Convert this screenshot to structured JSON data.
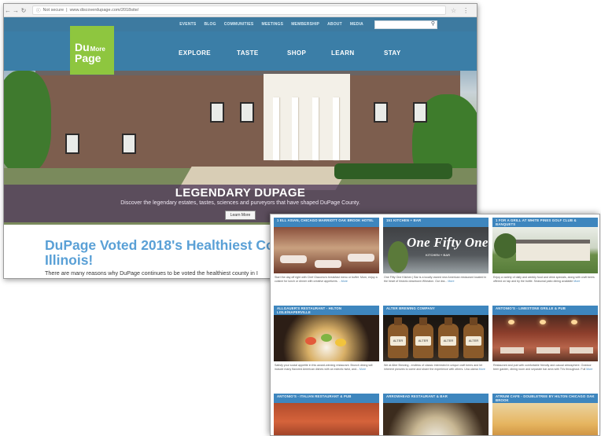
{
  "browser": {
    "security": "Not secure",
    "url": "www.discoverdupage.com/2018site/"
  },
  "site": {
    "top_links": [
      "EVENTS",
      "BLOG",
      "COMMUNITIES",
      "MEETINGS",
      "MEMBERSHIP",
      "ABOUT",
      "MEDIA"
    ],
    "logo_line1": "Du",
    "logo_more": "More",
    "logo_line2": "Page",
    "main_nav": [
      "EXPLORE",
      "TASTE",
      "SHOP",
      "LEARN",
      "STAY"
    ],
    "hero": {
      "title": "LEGENDARY DUPAGE",
      "subtitle": "Discover the legendary estates, tastes, sciences and purveyors that have shaped DuPage County.",
      "button": "Learn More"
    },
    "headline_line1": "DuPage Voted 2018's Healthiest Count",
    "headline_line2": "Illinois!",
    "intro": "There are many reasons why DuPage continues to be voted the healthiest county in I"
  },
  "cards": [
    {
      "title": "1 ELL ASIAN, CHICAGO MARRIOTT OAK BROOK HOTEL",
      "desc": "Start the day off right with Chef Giacomo's breakfast menu or buffet. Mom, enjoy a cuisine for lunch or dinner with creative appetizers.",
      "more": "...More"
    },
    {
      "title": "151 KITCHEN + BAR",
      "desc": "One Fifty One Kitchen | Bar is a locally owned new American restaurant located in the heart of historic downtown Wheaton. Our dra...",
      "more": "More",
      "sign": "One Fifty One",
      "sign_sub": "KITCHEN + BAR"
    },
    {
      "title": "1 FOR A GRILL AT WHITE PINES GOLF CLUB & BANQUETS",
      "desc": "Enjoy a variety of daily and weekly food and drink specials, along with craft beers offered on tap and by the bottle. Seasonal patio dining available",
      "more": "More"
    },
    {
      "title": "ALLGAUER'S RESTAURANT - HILTON LISLE/NAPERVILLE",
      "desc": "Satisfy your social appetite in this award-winning restaurant. Brunch dining will include many flavored American dishes with an eclectic twist, and...",
      "more": "More"
    },
    {
      "title": "ALTER BREWING COMPANY",
      "desc": "We at Alter Brewing - endless of classic interested in unique craft beers and let inherent pictures to come and share the experience with others. Una ulama",
      "more": "More",
      "bottle_label": "ALTER"
    },
    {
      "title": "ANTONIO'S - LIMESTONE GRILLE & PUB",
      "desc": "Restaurant and pub with comfortable friendly and casual atmosphere. Outdoor beer garden, dining room and separate bar area with TVs throughout. Full",
      "more": "More"
    },
    {
      "title": "ANTONIO'S - ITALIAN RESTAURANT & PUB",
      "desc": "",
      "more": ""
    },
    {
      "title": "ARROWHEAD RESTAURANT & BAR",
      "desc": "",
      "more": ""
    },
    {
      "title": "ATRIUM CAFE - DOUBLETREE BY HILTON CHICAGO OAK BROOK",
      "desc": "",
      "more": ""
    }
  ],
  "colors": {
    "site_blue": "#3b7ea7",
    "logo_green": "#8ec63f",
    "headline_blue": "#5aa0d6",
    "card_header": "#3e86be",
    "banner_purple": "#523c5c"
  }
}
